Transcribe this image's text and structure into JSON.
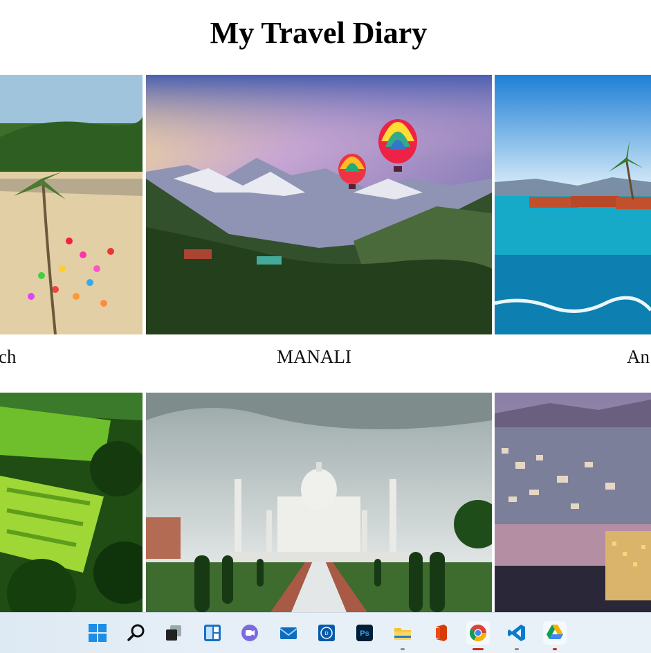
{
  "page": {
    "title": "My Travel Diary"
  },
  "destinations": [
    {
      "caption": "ch",
      "scene": "beach"
    },
    {
      "caption": "MANALI",
      "scene": "mountains-balloons"
    },
    {
      "caption": "An",
      "scene": "sea-coast"
    },
    {
      "caption": "",
      "scene": "hills-green"
    },
    {
      "caption": "",
      "scene": "taj-mahal"
    },
    {
      "caption": "",
      "scene": "city-lake"
    }
  ],
  "taskbar": {
    "icons": [
      "start-icon",
      "search-icon",
      "task-view-icon",
      "widgets-icon",
      "teams-chat-icon",
      "mail-icon",
      "dell-icon",
      "photoshop-icon",
      "file-explorer-icon",
      "office-icon",
      "chrome-icon",
      "vscode-icon",
      "google-drive-icon"
    ],
    "accent": "#0067c0"
  }
}
